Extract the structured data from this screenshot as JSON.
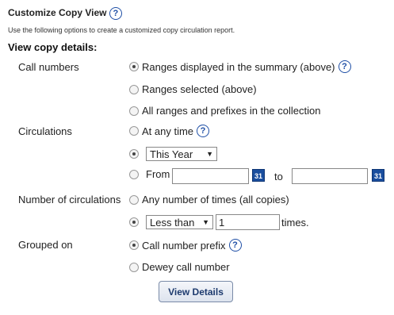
{
  "title": "Customize Copy View",
  "description": "Use the following options to create a customized copy circulation report.",
  "section_heading": "View copy details:",
  "call_numbers": {
    "label": "Call numbers",
    "options": [
      "Ranges displayed in the summary (above)",
      "Ranges selected (above)",
      "All ranges and prefixes in the collection"
    ]
  },
  "circulations": {
    "label": "Circulations",
    "any_time": "At any time",
    "period_select": "This Year",
    "from_label": "From",
    "to_label": "to",
    "from_value": "",
    "to_value": "",
    "calendar_glyph": "31"
  },
  "number_of_circulations": {
    "label": "Number of circulations",
    "any_number": "Any number of times (all copies)",
    "comparator_select": "Less than",
    "count_value": "1",
    "times_label": "times."
  },
  "grouped_on": {
    "label": "Grouped on",
    "options": [
      "Call number prefix",
      "Dewey call number"
    ]
  },
  "view_details_button": "View Details",
  "help_glyph": "?"
}
